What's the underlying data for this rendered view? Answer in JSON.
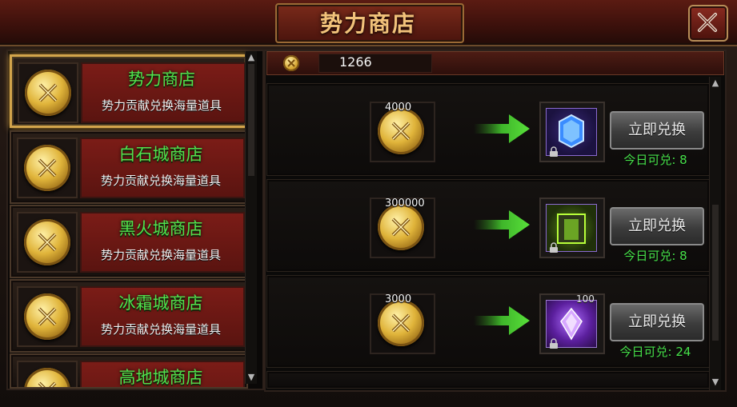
{
  "window": {
    "title": "势力商店"
  },
  "currency": {
    "icon": "faction-coin-icon",
    "value": "1266"
  },
  "shops": [
    {
      "name": "势力商店",
      "desc": "势力贡献兑换海量道具",
      "active": true
    },
    {
      "name": "白石城商店",
      "desc": "势力贡献兑换海量道具",
      "active": false
    },
    {
      "name": "黑火城商店",
      "desc": "势力贡献兑换海量道具",
      "active": false
    },
    {
      "name": "冰霜城商店",
      "desc": "势力贡献兑换海量道具",
      "active": false
    },
    {
      "name": "高地城商店",
      "desc": "",
      "active": false
    }
  ],
  "exchanges": [
    {
      "cost": "4000",
      "reward_icon": "blue-gem-icon",
      "reward_count": "",
      "button": "立即兑换",
      "limit": "今日可兑: 8"
    },
    {
      "cost": "300000",
      "reward_icon": "green-chest-icon",
      "reward_count": "",
      "button": "立即兑换",
      "limit": "今日可兑: 8"
    },
    {
      "cost": "3000",
      "reward_icon": "purple-crystal-icon",
      "reward_count": "100",
      "button": "立即兑换",
      "limit": "今日可兑: 24"
    }
  ],
  "colors": {
    "accent_gold": "#d2a44b",
    "shop_name_green": "#4fe24d",
    "limit_green": "#47e04a",
    "title_text": "#f1c27a"
  }
}
